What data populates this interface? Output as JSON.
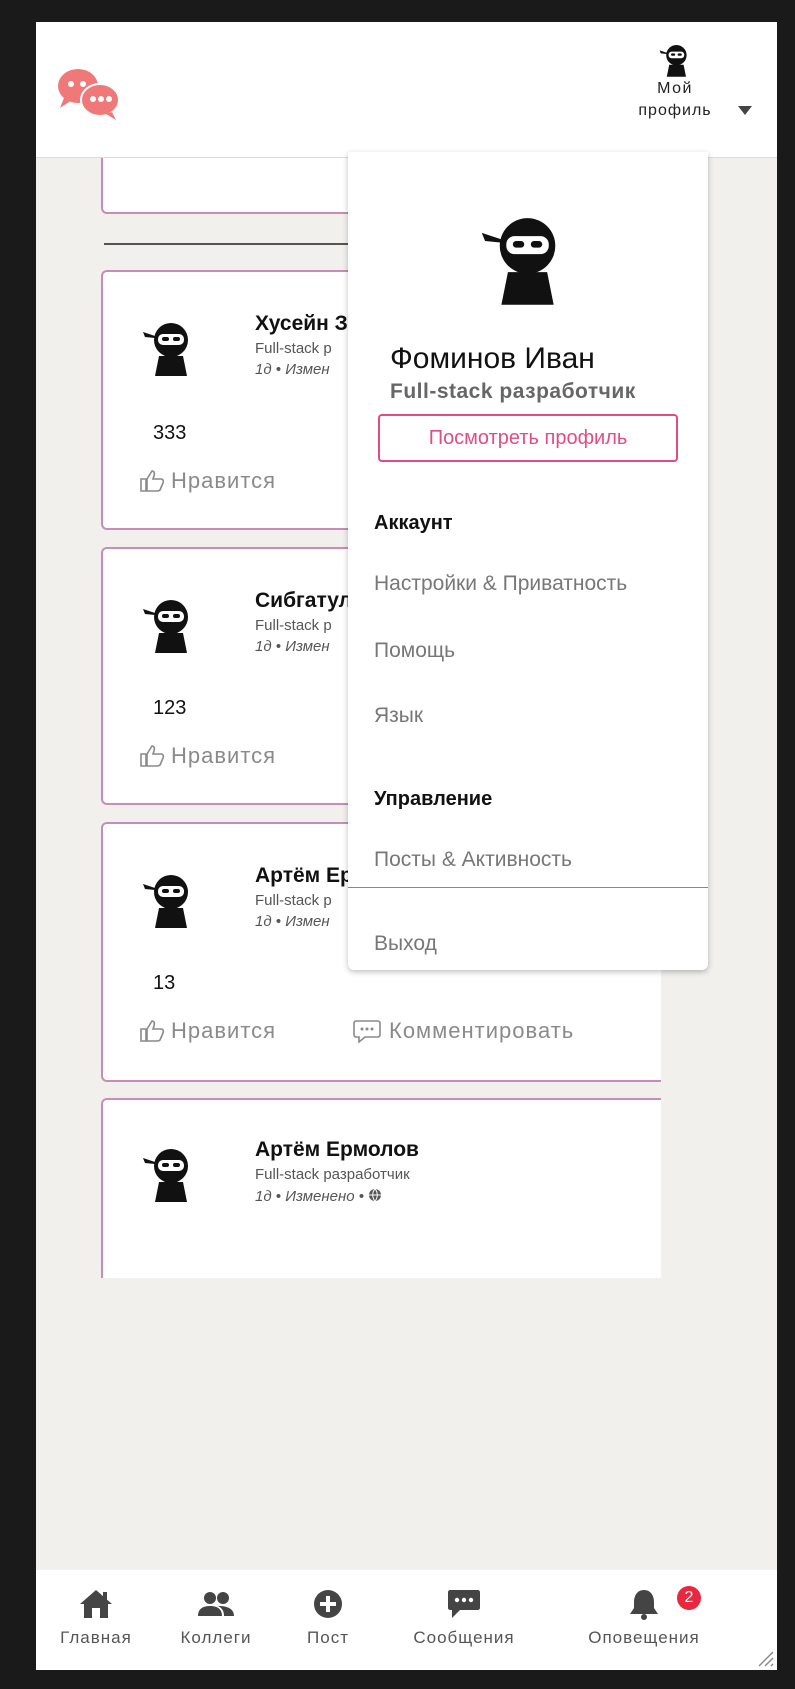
{
  "header": {
    "profile_label_line1": "Мой",
    "profile_label_line2": "профиль"
  },
  "posts": [
    {
      "author": "Хусейн З",
      "role": "Full-stack р",
      "meta": "1д • Измен",
      "text": "333",
      "like_label": "Нравится"
    },
    {
      "author": "Сибгатул",
      "role": "Full-stack р",
      "meta": "1д • Измен",
      "text": "123",
      "like_label": "Нравится"
    },
    {
      "author": "Артём Ер",
      "role": "Full-stack р",
      "meta": "1д • Измен",
      "text": "13",
      "like_label": "Нравится",
      "comment_label": "Комментировать"
    },
    {
      "author": "Артём Ермолов",
      "role": "Full-stack разработчик",
      "meta": "1д • Изменено • "
    }
  ],
  "dropdown": {
    "name": "Фоминов Иван",
    "role": "Full-stack разработчик",
    "view_profile_label": "Посмотреть профиль",
    "account_heading": "Аккаунт",
    "account_items": [
      "Настройки & Приватность",
      "Помощь",
      "Язык"
    ],
    "manage_heading": "Управление",
    "manage_items": [
      "Посты & Активность"
    ],
    "logout_label": "Выход"
  },
  "bottom_nav": {
    "items": [
      {
        "label": "Главная",
        "icon": "home-icon"
      },
      {
        "label": "Коллеги",
        "icon": "people-icon"
      },
      {
        "label": "Пост",
        "icon": "plus-circle-icon"
      },
      {
        "label": "Сообщения",
        "icon": "chat-icon"
      },
      {
        "label": "Оповещения",
        "icon": "bell-icon"
      }
    ],
    "notification_count": "2"
  },
  "colors": {
    "accent_pink": "#e24c86",
    "logo_coral": "#f07878",
    "card_border": "#c98bb8",
    "badge_red": "#e8283e"
  }
}
